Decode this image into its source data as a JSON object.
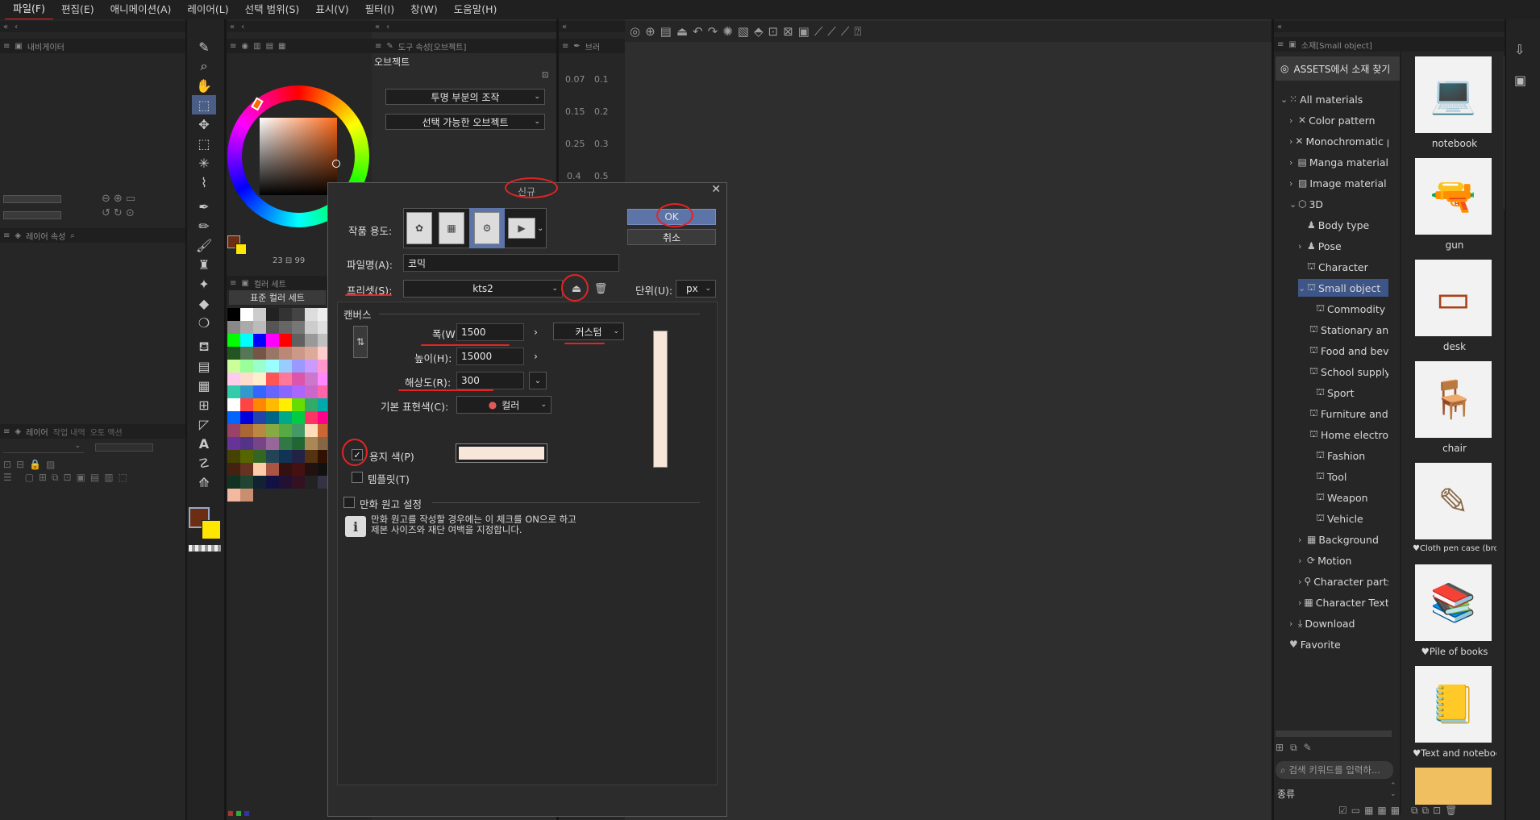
{
  "menubar": {
    "items": [
      "파일(F)",
      "편집(E)",
      "애니메이션(A)",
      "레이어(L)",
      "선택 범위(S)",
      "표시(V)",
      "필터(I)",
      "창(W)",
      "도움말(H)"
    ]
  },
  "panels": {
    "navigator_tab": "내비게이터",
    "layer_property_tab": "레이어 속성",
    "layer_tabs": [
      "레이어",
      "작업 내역",
      "오토 액션"
    ],
    "color_set_tab": "컬러 세트",
    "color_set_name": "표준 컬러 세트",
    "tool_property_tab": "도구 속성[오브젝트]",
    "brush_tab": "브러",
    "tool_property": {
      "title": "오브젝트",
      "dropdown1": "투명 부분의 조작",
      "dropdown2": "선택 가능한 오브젝트"
    },
    "color_readout": "23",
    "color_readout2": "99",
    "ruler_values": [
      "0.07",
      "0.1",
      "0.15",
      "0.2",
      "0.25",
      "0.3",
      "0.4",
      "0.5"
    ]
  },
  "dialog": {
    "title": "신규",
    "usage_label": "작품 용도:",
    "filename_label": "파일명(A):",
    "filename_value": "코믹",
    "preset_label": "프리셋(S):",
    "preset_value": "kts2",
    "unit_label": "단위(U):",
    "unit_value": "px",
    "ok_label": "OK",
    "cancel_label": "취소",
    "canvas_section": "캔버스",
    "width_label": "폭(W):",
    "width_value": "1500",
    "height_label": "높이(H):",
    "height_value": "15000",
    "resolution_label": "해상도(R):",
    "resolution_value": "300",
    "custom_label": "커스텀",
    "base_color_label": "기본 표현색(C):",
    "base_color_value": "컬러",
    "paper_color_label": "용지 색(P)",
    "paper_color_checked": true,
    "paper_color": "#f9e6da",
    "template_label": "템플릿(T)",
    "template_checked": false,
    "manga_label": "만화 원고 설정",
    "manga_checked": false,
    "info_line1": "만화 원고를 작성할 경우에는 이 체크를 ON으로 하고",
    "info_line2": "제본 사이즈와 재단 여백을 지정합니다."
  },
  "materials": {
    "tab_label": "소재[Small object]",
    "assets_button": "ASSETS에서 소재 찾기",
    "tree": [
      {
        "label": "All materials",
        "icon": "grid-icon"
      },
      {
        "label": "Color pattern",
        "icon": "pattern-icon"
      },
      {
        "label": "Monochromatic pa",
        "icon": "pattern-icon"
      },
      {
        "label": "Manga material",
        "icon": "folder-icon"
      },
      {
        "label": "Image material",
        "icon": "image-icon"
      },
      {
        "label": "3D",
        "icon": "cube-icon"
      },
      {
        "label": "Body type",
        "icon": "figure-icon"
      },
      {
        "label": "Pose",
        "icon": "figure-icon"
      },
      {
        "label": "Character",
        "icon": "person-icon"
      },
      {
        "label": "Small object",
        "icon": "object-icon"
      },
      {
        "label": "Commodity",
        "icon": "object-icon"
      },
      {
        "label": "Stationary and",
        "icon": "object-icon"
      },
      {
        "label": "Food and beve",
        "icon": "object-icon"
      },
      {
        "label": "School supply",
        "icon": "object-icon"
      },
      {
        "label": "Sport",
        "icon": "object-icon"
      },
      {
        "label": "Furniture and i",
        "icon": "object-icon"
      },
      {
        "label": "Home electron",
        "icon": "object-icon"
      },
      {
        "label": "Fashion",
        "icon": "object-icon"
      },
      {
        "label": "Tool",
        "icon": "object-icon"
      },
      {
        "label": "Weapon",
        "icon": "object-icon"
      },
      {
        "label": "Vehicle",
        "icon": "object-icon"
      },
      {
        "label": "Background",
        "icon": "background-icon"
      },
      {
        "label": "Motion",
        "icon": "motion-icon"
      },
      {
        "label": "Character parts",
        "icon": "parts-icon"
      },
      {
        "label": "Character Textu",
        "icon": "texture-icon"
      },
      {
        "label": "Download",
        "icon": "download-icon"
      },
      {
        "label": "Favorite",
        "icon": "heart-icon"
      }
    ],
    "thumbnails": [
      "notebook",
      "gun",
      "desk",
      "chair",
      "Cloth pen case (brow",
      "Pile of books",
      "Text and notebook"
    ],
    "search_placeholder": "검색 키워드를 입력하...",
    "kind_label": "종류"
  },
  "colors": {
    "accent": "#4a5d86",
    "annotation_red": "#e32424",
    "main_color": "#6b2e12",
    "sub_color": "#ffe600"
  }
}
